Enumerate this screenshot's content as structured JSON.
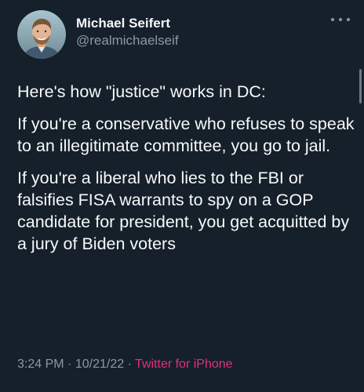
{
  "author": {
    "display_name": "Michael Seifert",
    "handle": "@realmichaelseif"
  },
  "tweet": {
    "paragraphs": [
      "Here's how \"justice\" works in DC:",
      "If you're a conservative who refuses to speak to an illegitimate committee, you go to jail.",
      "If you're a liberal who lies to the FBI or falsifies FISA warrants to spy on a GOP candidate for president, you get acquitted by a jury of Biden voters"
    ]
  },
  "meta": {
    "time": "3:24 PM",
    "separator": "·",
    "date": "10/21/22",
    "source": "Twitter for iPhone"
  },
  "colors": {
    "background": "#15202b",
    "text": "#f7f9f9",
    "secondary": "#8b98a5",
    "source_link": "#e2317b"
  },
  "icons": {
    "more": "more-icon"
  }
}
